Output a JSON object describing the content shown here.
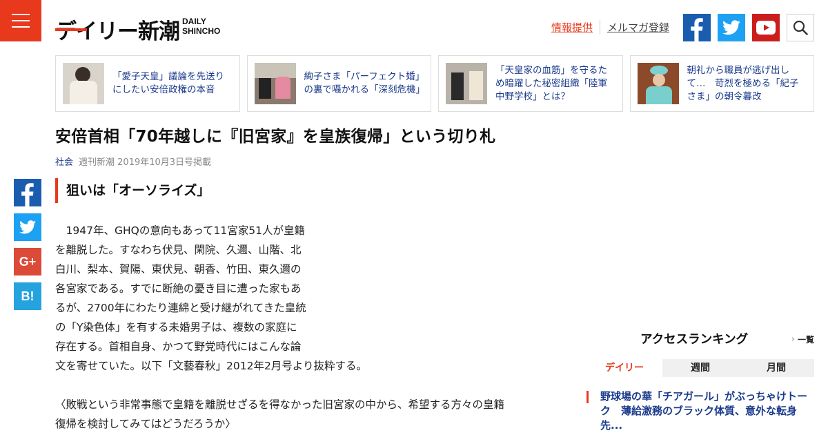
{
  "header": {
    "logo_jp": "デイリー新潮",
    "logo_en_line1": "DAILY",
    "logo_en_line2": "SHINCHO",
    "link_info": "情報提供",
    "link_mail": "メルマガ登録",
    "icons": [
      "menu-icon",
      "facebook-icon",
      "twitter-icon",
      "youtube-icon",
      "search-icon"
    ],
    "colors": {
      "brand_red": "#e8391d",
      "facebook": "#1a5daf",
      "twitter": "#1da1f2",
      "youtube": "#cc1d1d"
    }
  },
  "related": [
    {
      "title": "「愛子天皇」議論を先送りにしたい安倍政権の本音"
    },
    {
      "title": "絢子さま「パーフェクト婚」の裏で囁かれる「深刻危機」"
    },
    {
      "title": "「天皇家の血筋」を守るため暗躍した秘密組織「陸軍中野学校」とは？"
    },
    {
      "title": "朝礼から職員が逃げ出して…　苛烈を極める「紀子さま」の朝令暮改"
    }
  ],
  "article": {
    "title": "安倍首相「70年越しに『旧宮家』を皇族復帰」という切り札",
    "category": "社会",
    "source": "週刊新潮 2019年10月3日号掲載",
    "subheading": "狙いは「オーソライズ」",
    "body": "　1947年、GHQの意向もあって11宮家51人が皇籍\nを離脱した。すなわち伏見、閑院、久邇、山階、北\n白川、梨本、賀陽、東伏見、朝香、竹田、東久邇の\n各宮家である。すでに断絶の憂き目に遭った家もあ\nるが、2700年にわたり連綿と受け継がれてきた皇統\nの「Y染色体」を有する未婚男子は、複数の家庭に\n存在する。首相自身、かつて野党時代にはこんな論\n文を寄せていた。以下「文藝春秋」2012年2月号より抜粋する。",
    "quote": "〈敗戦という非常事態で皇籍を離脱せざるを得なかった旧宮家の中から、希望する方々の皇籍\n復帰を検討してみてはどうだろうか〉"
  },
  "share": {
    "googleplus_label": "G+",
    "hatena_label": "B!",
    "icons": [
      "facebook-icon",
      "twitter-icon",
      "googleplus-icon",
      "hatena-bookmark-icon"
    ]
  },
  "ranking": {
    "title": "アクセスランキング",
    "more_label": "一覧",
    "tabs": [
      "デイリー",
      "週間",
      "月間"
    ],
    "active_tab": "デイリー",
    "items": [
      {
        "title": "野球場の華「チアガール」がぶっちゃけトーク　薄給激務のブラック体質、意外な転身先..."
      }
    ]
  }
}
